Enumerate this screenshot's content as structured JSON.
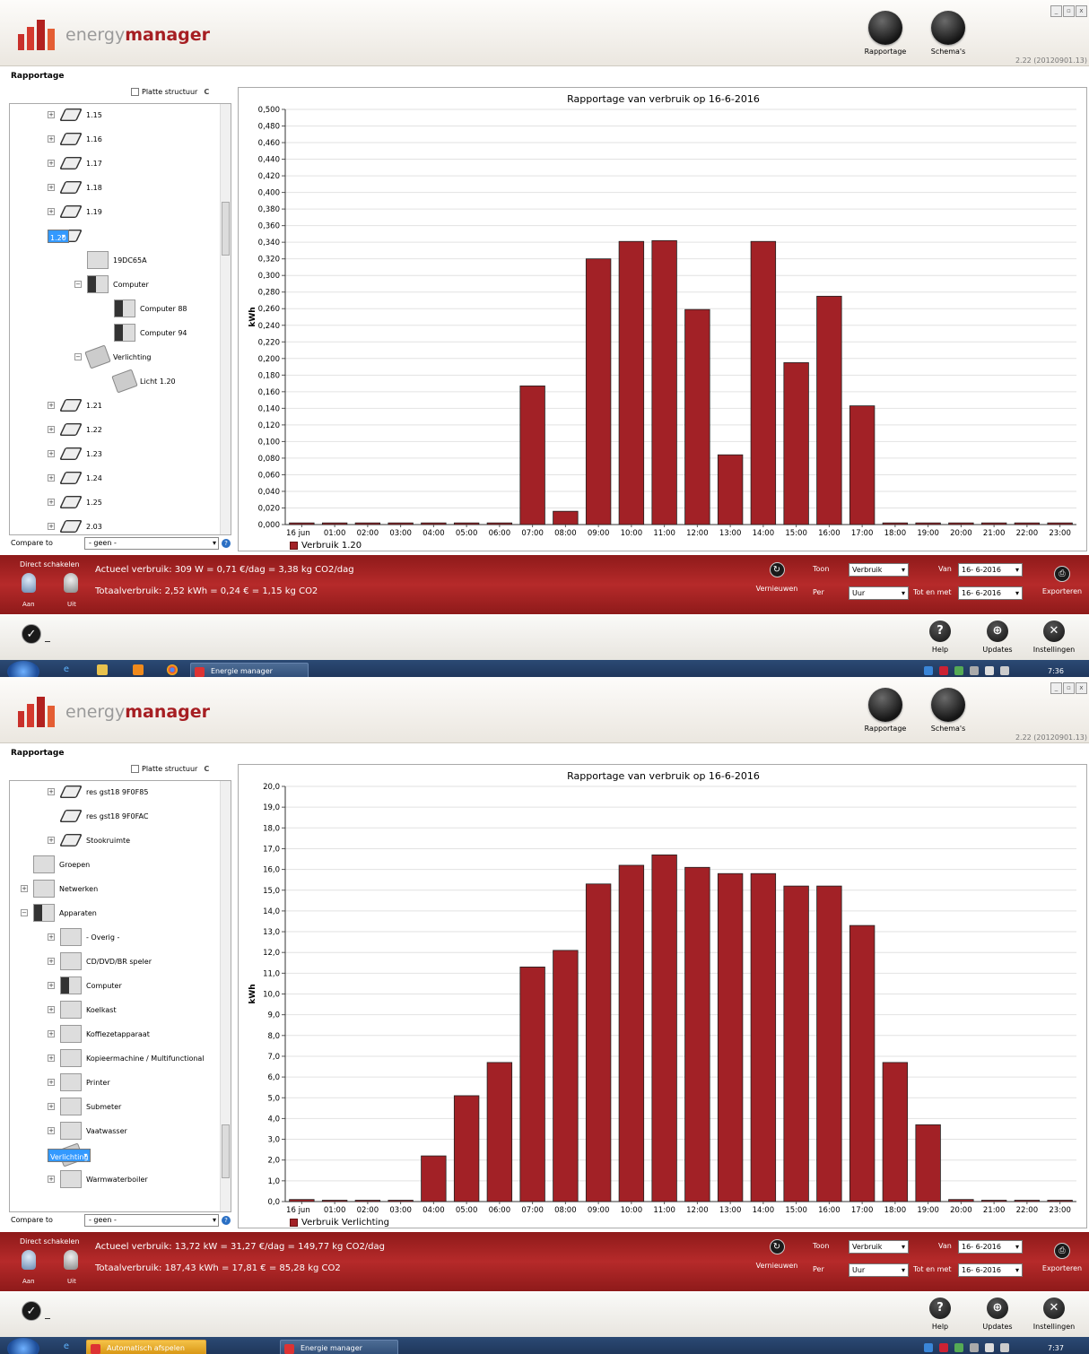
{
  "windows": [
    {
      "app": {
        "brand_light": "energy",
        "brand_bold": "manager",
        "version": "2.22 (20120901.13)"
      },
      "toolbar": {
        "rapportage": "Rapportage",
        "schemas": "Schema's"
      },
      "section": "Rapportage",
      "flat_label": "Platte structuur",
      "tree": [
        {
          "label": "1.15",
          "type": "room",
          "indent": 1,
          "pm": "+"
        },
        {
          "label": "1.16",
          "type": "room",
          "indent": 1,
          "pm": "+"
        },
        {
          "label": "1.17",
          "type": "room",
          "indent": 1,
          "pm": "+"
        },
        {
          "label": "1.18",
          "type": "room",
          "indent": 1,
          "pm": "+"
        },
        {
          "label": "1.19",
          "type": "room",
          "indent": 1,
          "pm": "+"
        },
        {
          "label": "1.20",
          "type": "room",
          "indent": 1,
          "pm": "−",
          "selected": true
        },
        {
          "label": "19DC65A",
          "type": "box",
          "indent": 2,
          "pm": ""
        },
        {
          "label": "Computer",
          "type": "dev",
          "indent": 2,
          "pm": "−"
        },
        {
          "label": "Computer 88",
          "type": "dev",
          "indent": 3,
          "pm": ""
        },
        {
          "label": "Computer 94",
          "type": "dev",
          "indent": 3,
          "pm": ""
        },
        {
          "label": "Verlichting",
          "type": "lamp",
          "indent": 2,
          "pm": "−"
        },
        {
          "label": "Licht 1.20",
          "type": "lamp",
          "indent": 3,
          "pm": ""
        },
        {
          "label": "1.21",
          "type": "room",
          "indent": 1,
          "pm": "+"
        },
        {
          "label": "1.22",
          "type": "room",
          "indent": 1,
          "pm": "+"
        },
        {
          "label": "1.23",
          "type": "room",
          "indent": 1,
          "pm": "+"
        },
        {
          "label": "1.24",
          "type": "room",
          "indent": 1,
          "pm": "+"
        },
        {
          "label": "1.25",
          "type": "room",
          "indent": 1,
          "pm": "+"
        },
        {
          "label": "2.03",
          "type": "room",
          "indent": 1,
          "pm": "+"
        }
      ],
      "scroll_fraction": 0.25,
      "compare": {
        "label": "Compare to",
        "value": "- geen -"
      },
      "chart_data": {
        "type": "bar",
        "title": "Rapportage van verbruik op 16-6-2016",
        "ylabel": "kWh",
        "categories": [
          "16 jun",
          "01:00",
          "02:00",
          "03:00",
          "04:00",
          "05:00",
          "06:00",
          "07:00",
          "08:00",
          "09:00",
          "10:00",
          "11:00",
          "12:00",
          "13:00",
          "14:00",
          "15:00",
          "16:00",
          "17:00",
          "18:00",
          "19:00",
          "20:00",
          "21:00",
          "22:00",
          "23:00"
        ],
        "series": [
          {
            "name": "Verbruik 1.20",
            "values": [
              0.002,
              0.002,
              0.002,
              0.002,
              0.002,
              0.002,
              0.002,
              0.167,
              0.016,
              0.32,
              0.341,
              0.342,
              0.259,
              0.084,
              0.341,
              0.195,
              0.275,
              0.143,
              0.002,
              0.002,
              0.002,
              0.002,
              0.002,
              0.002
            ]
          }
        ],
        "ylim": [
          0,
          0.5
        ],
        "ytick_step": 0.02,
        "ytick_labels": [
          "0,000",
          "0,020",
          "0,040",
          "0,060",
          "0,080",
          "0,100",
          "0,120",
          "0,140",
          "0,160",
          "0,180",
          "0,200",
          "0,220",
          "0,240",
          "0,260",
          "0,280",
          "0,300",
          "0,320",
          "0,340",
          "0,360",
          "0,380",
          "0,400",
          "0,420",
          "0,440",
          "0,460",
          "0,480",
          "0,500"
        ],
        "grid": true,
        "legend": "bottom-left",
        "color": "#a22126"
      },
      "status": {
        "direct": "Direct schakelen",
        "aan": "Aan",
        "uit": "Uit",
        "actueel": "Actueel verbruik: 309 W = 0,71 €/dag = 3,38 kg CO2/dag",
        "totaal": "Totaalverbruik: 2,52 kWh = 0,24 € = 1,15 kg CO2",
        "vernieuwen": "Vernieuwen",
        "toon_label": "Toon",
        "toon_value": "Verbruik",
        "per_label": "Per",
        "per_value": "Uur",
        "van_label": "Van",
        "van_value": "16- 6-2016",
        "tot_label": "Tot en met",
        "tot_value": "16- 6-2016",
        "exporteren": "Exporteren"
      },
      "bottom": {
        "help": "Help",
        "updates": "Updates",
        "instellingen": "Instellingen"
      },
      "taskbar": {
        "tasks": [
          {
            "label": "Energie manager",
            "style": "n",
            "left": 212,
            "width": 132
          }
        ],
        "clock": "7:36"
      }
    },
    {
      "app": {
        "brand_light": "energy",
        "brand_bold": "manager",
        "version": "2.22 (20120901.13)"
      },
      "toolbar": {
        "rapportage": "Rapportage",
        "schemas": "Schema's"
      },
      "section": "Rapportage",
      "flat_label": "Platte structuur",
      "tree": [
        {
          "label": "res gst18 9F0F85",
          "type": "room",
          "indent": 1,
          "pm": "+"
        },
        {
          "label": "res gst18 9F0FAC",
          "type": "room",
          "indent": 1,
          "pm": ""
        },
        {
          "label": "Stookruimte",
          "type": "room",
          "indent": 1,
          "pm": "+"
        },
        {
          "label": "Groepen",
          "type": "box",
          "indent": 0,
          "pm": ""
        },
        {
          "label": "Netwerken",
          "type": "box",
          "indent": 0,
          "pm": "+"
        },
        {
          "label": "Apparaten",
          "type": "dev",
          "indent": 0,
          "pm": "−"
        },
        {
          "label": "- Overig -",
          "type": "box",
          "indent": 1,
          "pm": "+"
        },
        {
          "label": "CD/DVD/BR speler",
          "type": "box",
          "indent": 1,
          "pm": "+"
        },
        {
          "label": "Computer",
          "type": "dev",
          "indent": 1,
          "pm": "+"
        },
        {
          "label": "Koelkast",
          "type": "box",
          "indent": 1,
          "pm": "+"
        },
        {
          "label": "Koffiezetapparaat",
          "type": "box",
          "indent": 1,
          "pm": "+"
        },
        {
          "label": "Kopieermachine / Multifunctional",
          "type": "box",
          "indent": 1,
          "pm": "+"
        },
        {
          "label": "Printer",
          "type": "box",
          "indent": 1,
          "pm": "+"
        },
        {
          "label": "Submeter",
          "type": "box",
          "indent": 1,
          "pm": "+"
        },
        {
          "label": "Vaatwasser",
          "type": "box",
          "indent": 1,
          "pm": "+"
        },
        {
          "label": "Verlichting",
          "type": "lamp",
          "indent": 1,
          "pm": "+",
          "selected": true
        },
        {
          "label": "Warmwaterboiler",
          "type": "box",
          "indent": 1,
          "pm": "+"
        }
      ],
      "scroll_fraction": 0.92,
      "compare": {
        "label": "Compare to",
        "value": "- geen -"
      },
      "chart_data": {
        "type": "bar",
        "title": "Rapportage van verbruik op 16-6-2016",
        "ylabel": "kWh",
        "categories": [
          "16 jun",
          "01:00",
          "02:00",
          "03:00",
          "04:00",
          "05:00",
          "06:00",
          "07:00",
          "08:00",
          "09:00",
          "10:00",
          "11:00",
          "12:00",
          "13:00",
          "14:00",
          "15:00",
          "16:00",
          "17:00",
          "18:00",
          "19:00",
          "20:00",
          "21:00",
          "22:00",
          "23:00"
        ],
        "series": [
          {
            "name": "Verbruik Verlichting",
            "values": [
              0.1,
              0,
              0,
              0,
              2.2,
              5.1,
              6.7,
              11.3,
              12.1,
              15.3,
              16.2,
              16.7,
              16.1,
              15.8,
              15.8,
              15.2,
              15.2,
              13.3,
              6.7,
              3.7,
              0.1,
              0,
              0,
              0
            ]
          }
        ],
        "ylim": [
          0,
          20
        ],
        "ytick_step": 1,
        "ytick_labels": [
          "0,0",
          "1,0",
          "2,0",
          "3,0",
          "4,0",
          "5,0",
          "6,0",
          "7,0",
          "8,0",
          "9,0",
          "10,0",
          "11,0",
          "12,0",
          "13,0",
          "14,0",
          "15,0",
          "16,0",
          "17,0",
          "18,0",
          "19,0",
          "20,0"
        ],
        "grid": true,
        "legend": "bottom-left",
        "color": "#a22126"
      },
      "status": {
        "direct": "Direct schakelen",
        "aan": "Aan",
        "uit": "Uit",
        "actueel": "Actueel verbruik: 13,72 kW = 31,27 €/dag = 149,77 kg CO2/dag",
        "totaal": "Totaalverbruik: 187,43 kWh = 17,81 € = 85,28 kg CO2",
        "vernieuwen": "Vernieuwen",
        "toon_label": "Toon",
        "toon_value": "Verbruik",
        "per_label": "Per",
        "per_value": "Uur",
        "van_label": "Van",
        "van_value": "16- 6-2016",
        "tot_label": "Tot en met",
        "tot_value": "16- 6-2016",
        "exporteren": "Exporteren"
      },
      "bottom": {
        "help": "Help",
        "updates": "Updates",
        "instellingen": "Instellingen"
      },
      "taskbar": {
        "tasks": [
          {
            "label": "Automatisch afspelen",
            "style": "y",
            "left": 96,
            "width": 134
          },
          {
            "label": "Energie manager",
            "style": "n",
            "left": 312,
            "width": 132
          }
        ],
        "clock": "7:37"
      }
    }
  ]
}
